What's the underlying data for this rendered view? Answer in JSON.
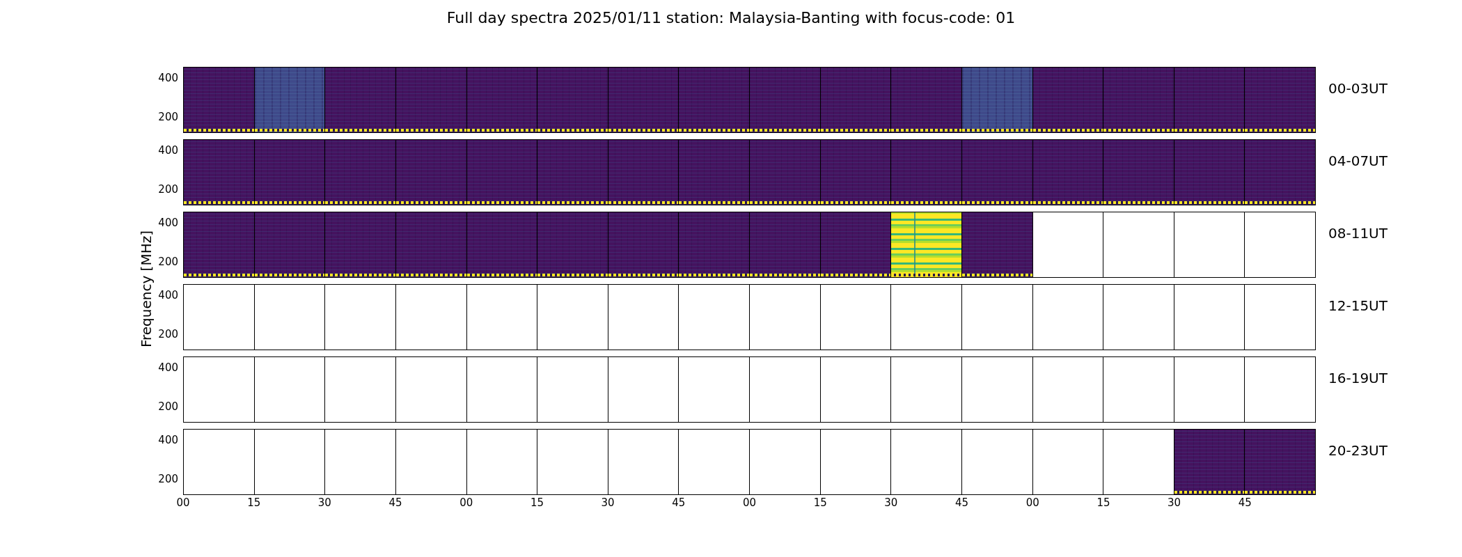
{
  "title": "Full day spectra 2025/01/11 station: Malaysia-Banting with focus-code: 01",
  "ylabel": "Frequency [MHz]",
  "rows": [
    {
      "label": "00-03UT",
      "yticks": [
        "400",
        "200"
      ],
      "panels": [
        {
          "kind": "dark"
        },
        {
          "kind": "light"
        },
        {
          "kind": "dark"
        },
        {
          "kind": "dark"
        },
        {
          "kind": "dark"
        },
        {
          "kind": "dark"
        },
        {
          "kind": "dark"
        },
        {
          "kind": "dark"
        },
        {
          "kind": "dark"
        },
        {
          "kind": "dark"
        },
        {
          "kind": "dark"
        },
        {
          "kind": "light"
        },
        {
          "kind": "dark"
        },
        {
          "kind": "dark"
        },
        {
          "kind": "dark"
        },
        {
          "kind": "dark"
        }
      ]
    },
    {
      "label": "04-07UT",
      "yticks": [
        "400",
        "200"
      ],
      "panels": [
        {
          "kind": "dark"
        },
        {
          "kind": "dark"
        },
        {
          "kind": "dark"
        },
        {
          "kind": "dark"
        },
        {
          "kind": "dark"
        },
        {
          "kind": "dark"
        },
        {
          "kind": "dark"
        },
        {
          "kind": "dark"
        },
        {
          "kind": "dark"
        },
        {
          "kind": "dark"
        },
        {
          "kind": "dark"
        },
        {
          "kind": "dark"
        },
        {
          "kind": "dark"
        },
        {
          "kind": "dark"
        },
        {
          "kind": "dark"
        },
        {
          "kind": "dark"
        }
      ]
    },
    {
      "label": "08-11UT",
      "yticks": [
        "400",
        "200"
      ],
      "panels": [
        {
          "kind": "dark"
        },
        {
          "kind": "dark"
        },
        {
          "kind": "dark"
        },
        {
          "kind": "dark"
        },
        {
          "kind": "dark"
        },
        {
          "kind": "dark"
        },
        {
          "kind": "dark"
        },
        {
          "kind": "dark"
        },
        {
          "kind": "dark"
        },
        {
          "kind": "dark"
        },
        {
          "kind": "bright"
        },
        {
          "kind": "dark"
        },
        {
          "kind": "empty"
        },
        {
          "kind": "empty"
        },
        {
          "kind": "empty"
        },
        {
          "kind": "empty"
        }
      ]
    },
    {
      "label": "12-15UT",
      "yticks": [
        "400",
        "200"
      ],
      "panels": [
        {
          "kind": "empty"
        },
        {
          "kind": "empty"
        },
        {
          "kind": "empty"
        },
        {
          "kind": "empty"
        },
        {
          "kind": "empty"
        },
        {
          "kind": "empty"
        },
        {
          "kind": "empty"
        },
        {
          "kind": "empty"
        },
        {
          "kind": "empty"
        },
        {
          "kind": "empty"
        },
        {
          "kind": "empty"
        },
        {
          "kind": "empty"
        },
        {
          "kind": "empty"
        },
        {
          "kind": "empty"
        },
        {
          "kind": "empty"
        },
        {
          "kind": "empty"
        }
      ]
    },
    {
      "label": "16-19UT",
      "yticks": [
        "400",
        "200"
      ],
      "panels": [
        {
          "kind": "empty"
        },
        {
          "kind": "empty"
        },
        {
          "kind": "empty"
        },
        {
          "kind": "empty"
        },
        {
          "kind": "empty"
        },
        {
          "kind": "empty"
        },
        {
          "kind": "empty"
        },
        {
          "kind": "empty"
        },
        {
          "kind": "empty"
        },
        {
          "kind": "empty"
        },
        {
          "kind": "empty"
        },
        {
          "kind": "empty"
        },
        {
          "kind": "empty"
        },
        {
          "kind": "empty"
        },
        {
          "kind": "empty"
        },
        {
          "kind": "empty"
        }
      ]
    },
    {
      "label": "20-23UT",
      "yticks": [
        "400",
        "200"
      ],
      "panels": [
        {
          "kind": "empty"
        },
        {
          "kind": "empty"
        },
        {
          "kind": "empty"
        },
        {
          "kind": "empty"
        },
        {
          "kind": "empty"
        },
        {
          "kind": "empty"
        },
        {
          "kind": "empty"
        },
        {
          "kind": "empty"
        },
        {
          "kind": "empty"
        },
        {
          "kind": "empty"
        },
        {
          "kind": "empty"
        },
        {
          "kind": "empty"
        },
        {
          "kind": "empty"
        },
        {
          "kind": "empty"
        },
        {
          "kind": "dark"
        },
        {
          "kind": "dark"
        }
      ]
    }
  ],
  "xticks": [
    "00",
    "15",
    "30",
    "45",
    "00",
    "15",
    "30",
    "45",
    "00",
    "15",
    "30",
    "45",
    "00",
    "15",
    "30",
    "45"
  ]
}
